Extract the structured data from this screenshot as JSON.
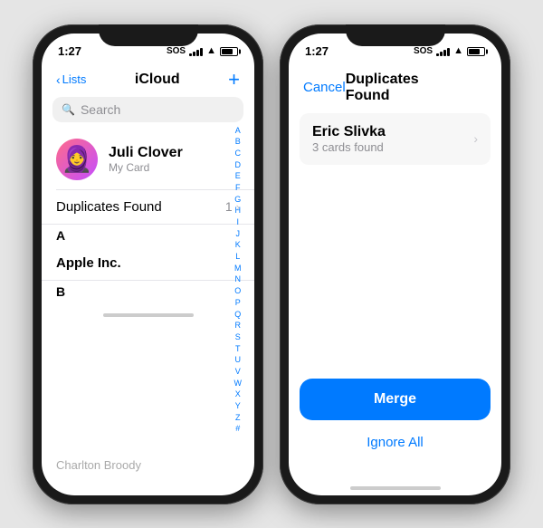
{
  "phone1": {
    "status": {
      "time": "1:27",
      "sos": "SOS",
      "signal_bars": [
        3,
        5,
        7,
        9,
        11
      ],
      "wifi": "wifi",
      "battery": 75
    },
    "nav": {
      "back_label": "Lists",
      "title": "iCloud",
      "add_label": "+"
    },
    "search": {
      "placeholder": "Search"
    },
    "my_card": {
      "name": "Juli Clover",
      "subtitle": "My Card",
      "avatar_emoji": "👩"
    },
    "sections": [
      {
        "label": "Duplicates Found",
        "badge": "1",
        "has_chevron": true
      }
    ],
    "alpha_section": "A",
    "apple_inc": "Apple Inc.",
    "section_b": "B",
    "alpha_letters": [
      "A",
      "B",
      "C",
      "D",
      "E",
      "F",
      "G",
      "H",
      "I",
      "J",
      "K",
      "L",
      "M",
      "N",
      "O",
      "P",
      "Q",
      "R",
      "S",
      "T",
      "U",
      "V",
      "W",
      "X",
      "Y",
      "Z",
      "#"
    ],
    "bottom_name": "Charlton Broody"
  },
  "phone2": {
    "status": {
      "time": "1:27",
      "sos": "SOS",
      "signal_bars": [
        3,
        5,
        7,
        9,
        11
      ],
      "wifi": "wifi",
      "battery": 75
    },
    "header": {
      "cancel_label": "Cancel",
      "title": "Duplicates Found"
    },
    "duplicate_entry": {
      "name": "Eric Slivka",
      "count": "3 cards found"
    },
    "actions": {
      "merge_label": "Merge",
      "ignore_label": "Ignore All"
    }
  }
}
